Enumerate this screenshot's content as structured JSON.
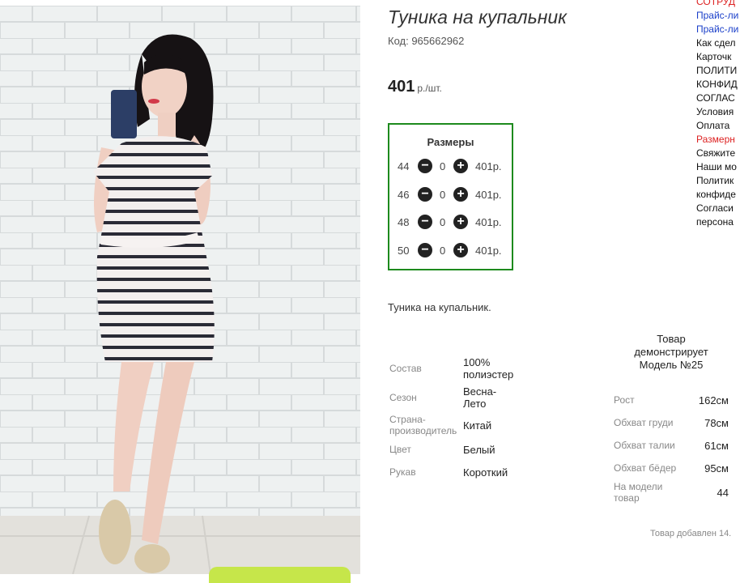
{
  "product": {
    "title": "Туника на купальник",
    "code": "Код: 965662962",
    "price": "401",
    "price_unit": "р./шт.",
    "description": "Туника на купальник."
  },
  "sizes": {
    "title": "Размеры",
    "rows": [
      {
        "size": "44",
        "qty": "0",
        "price": "401р."
      },
      {
        "size": "46",
        "qty": "0",
        "price": "401р."
      },
      {
        "size": "48",
        "qty": "0",
        "price": "401р."
      },
      {
        "size": "50",
        "qty": "0",
        "price": "401р."
      }
    ]
  },
  "attributes": [
    {
      "label": "Состав",
      "value": "100% полиэстер"
    },
    {
      "label": "Сезон",
      "value": "Весна-Лето"
    },
    {
      "label": "Страна-производитель",
      "value": "Китай"
    },
    {
      "label": "Цвет",
      "value": "Белый"
    },
    {
      "label": "Рукав",
      "value": "Короткий"
    }
  ],
  "model": {
    "heading": "Товар демонстрирует Модель №25",
    "rows": [
      {
        "label": "Рост",
        "value": "162см"
      },
      {
        "label": "Обхват груди",
        "value": "78см"
      },
      {
        "label": "Обхват талии",
        "value": "61см"
      },
      {
        "label": "Обхват бёдер",
        "value": "95см"
      },
      {
        "label": "На модели товар",
        "value": "44"
      }
    ]
  },
  "added_text": "Товар добавлен 14.",
  "sidebar_links": [
    {
      "label": "СОТРУД",
      "color": "red"
    },
    {
      "label": "Прайс-ли",
      "color": "blue"
    },
    {
      "label": "Прайс-ли",
      "color": "blue"
    },
    {
      "label": "Как сдел",
      "color": "dark"
    },
    {
      "label": "Карточк",
      "color": "dark"
    },
    {
      "label": "ПОЛИТИ",
      "color": "dark"
    },
    {
      "label": "КОНФИД",
      "color": "dark"
    },
    {
      "label": "СОГЛАС",
      "color": "dark"
    },
    {
      "label": "Условия",
      "color": "dark"
    },
    {
      "label": "Оплата",
      "color": "dark"
    },
    {
      "label": "Размерн",
      "color": "red"
    },
    {
      "label": "Свяжите",
      "color": "dark"
    },
    {
      "label": "Наши мо",
      "color": "dark"
    },
    {
      "label": "Политик",
      "color": "dark"
    },
    {
      "label": "конфиде",
      "color": "dark"
    },
    {
      "label": "Согласи",
      "color": "dark"
    },
    {
      "label": "персона",
      "color": "dark"
    }
  ],
  "colors": {
    "size_box_border": "#1d8a1d",
    "accent_button": "#c6e64a"
  }
}
